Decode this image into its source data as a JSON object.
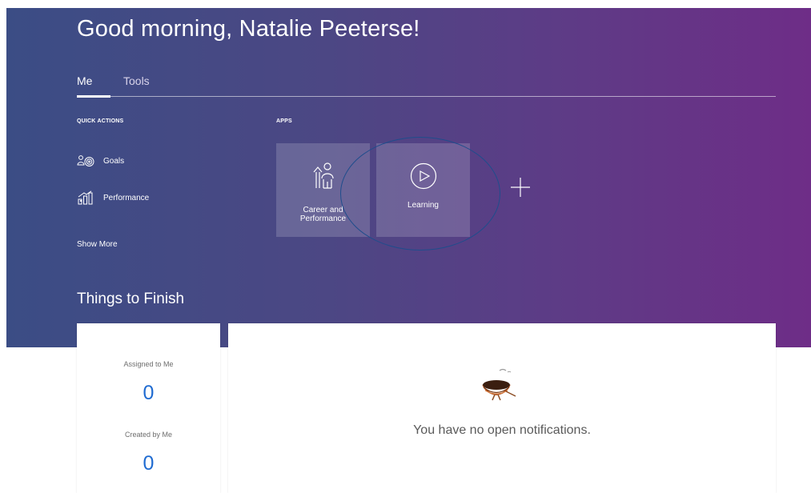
{
  "greeting": "Good morning, Natalie Peeterse!",
  "tabs": [
    {
      "label": "Me",
      "selected": true
    },
    {
      "label": "Tools",
      "selected": false
    }
  ],
  "quick_actions": {
    "heading": "QUICK ACTIONS",
    "items": [
      {
        "label": "Goals",
        "icon": "goals-icon"
      },
      {
        "label": "Performance",
        "icon": "performance-chart-icon"
      }
    ],
    "show_more": "Show More"
  },
  "apps": {
    "heading": "APPS",
    "tiles": [
      {
        "label_line1": "Career and",
        "label_line2": "Performance",
        "icon": "career-performance-icon"
      },
      {
        "label": "Learning",
        "icon": "play-circle-icon"
      }
    ],
    "add_icon": "plus-icon"
  },
  "things_to_finish": {
    "title": "Things to Finish",
    "assigned_label": "Assigned to Me",
    "assigned_count": "0",
    "created_label": "Created by Me",
    "created_count": "0",
    "empty_message": "You have no open notifications.",
    "empty_icon": "bird-nest-icon"
  },
  "colors": {
    "hero_start": "#3b4d85",
    "hero_end": "#6e2d87",
    "count_blue": "#1f6bd1",
    "annotation_ring": "#1f4d8c"
  }
}
